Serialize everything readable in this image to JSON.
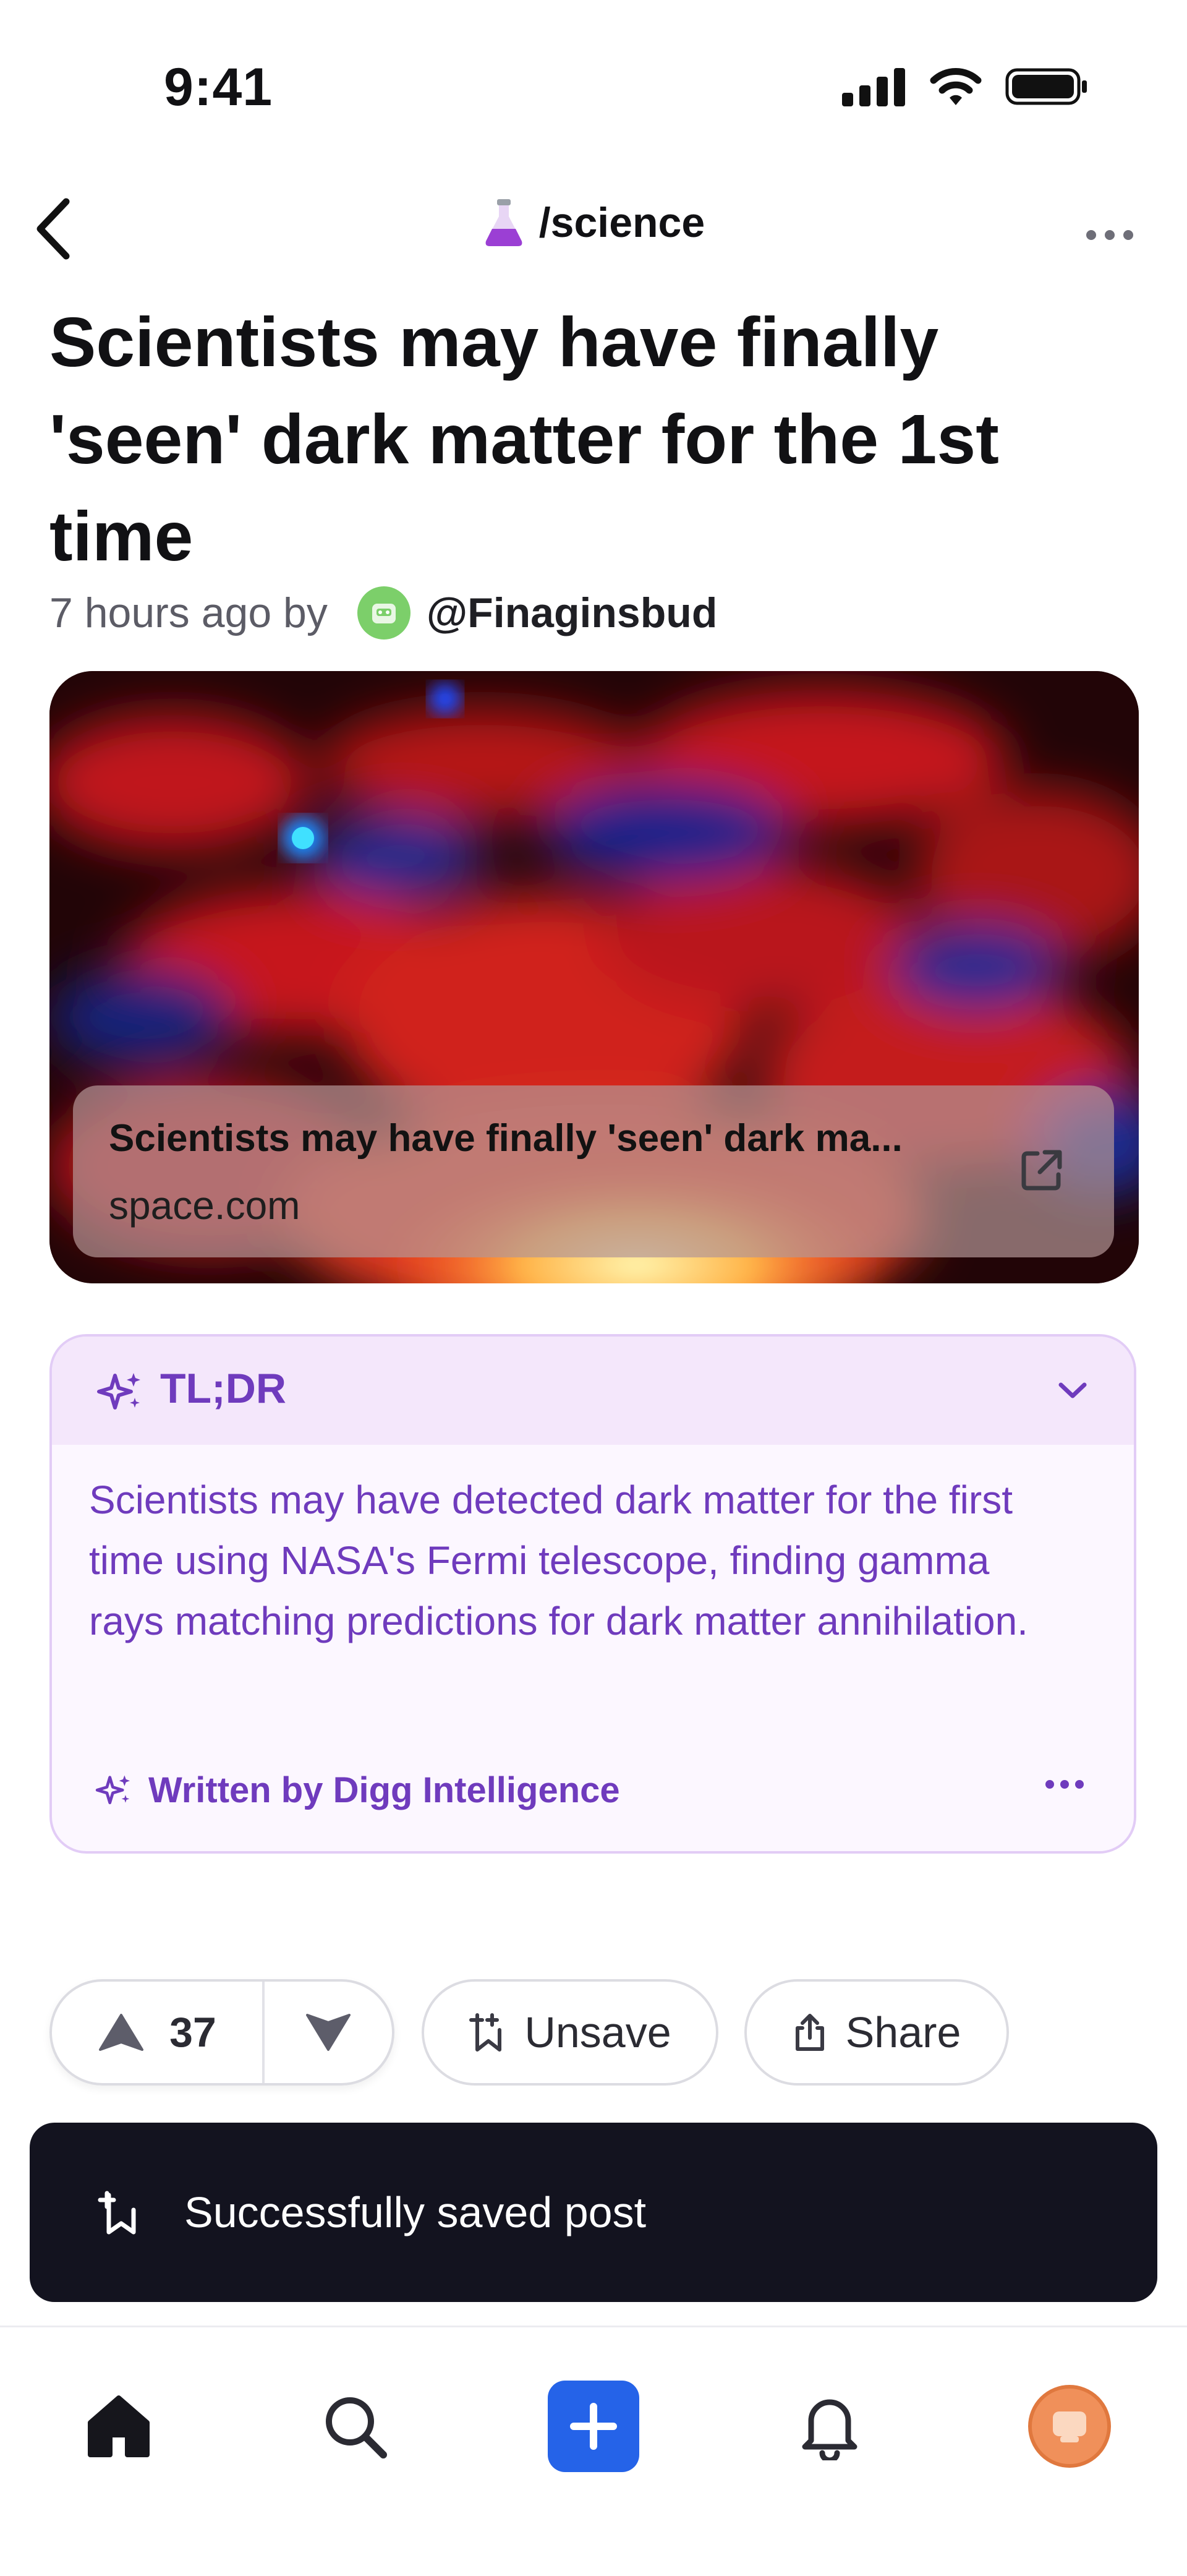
{
  "status_bar": {
    "time": "9:41",
    "icons": [
      "signal-icon",
      "wifi-icon",
      "battery-icon"
    ]
  },
  "header": {
    "community": "/science",
    "community_icon": "flask-icon",
    "back_icon": "chevron-left-icon",
    "more_icon": "more-horizontal-icon"
  },
  "post": {
    "title": "Scientists may have finally 'seen' dark matter for the 1st time",
    "time_ago": "7 hours ago by",
    "author": "@Finaginsbud"
  },
  "link_preview": {
    "title": "Scientists may have finally 'seen' dark ma...",
    "domain": "space.com",
    "icon": "external-link-icon"
  },
  "tldr": {
    "label": "TL;DR",
    "body": "Scientists may have detected dark matter for the first time using NASA's Fermi telescope, finding gamma rays matching predictions for dark matter annihilation.",
    "footer": "Written by Digg Intelligence",
    "accent_color": "#6f3bbd"
  },
  "actions": {
    "vote_count": "37",
    "unsave_label": "Unsave",
    "share_label": "Share"
  },
  "toast": {
    "message": "Successfully saved post"
  },
  "tabbar": {
    "items": [
      "home-icon",
      "search-icon",
      "create-icon",
      "notifications-icon",
      "profile-icon"
    ],
    "create_color": "#2563e8"
  }
}
